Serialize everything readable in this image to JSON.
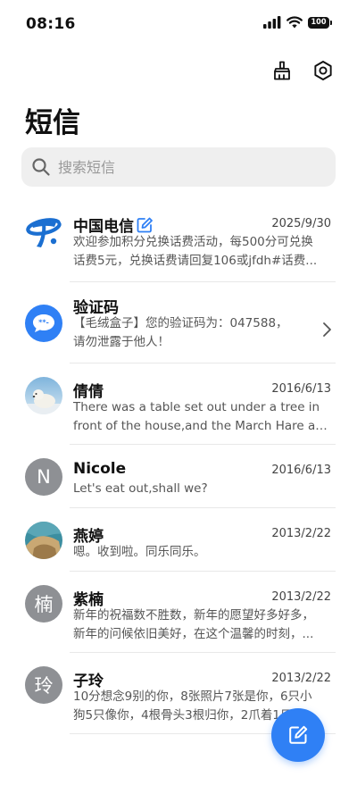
{
  "status_bar": {
    "time": "08:16",
    "battery": "100"
  },
  "header": {
    "title": "短信"
  },
  "search": {
    "placeholder": "搜索短信"
  },
  "colors": {
    "accent": "#2f80f5",
    "avatar_gray": "#8e9094"
  },
  "messages": [
    {
      "name": "中国电信",
      "avatar": "china-telecom-logo",
      "verified_icon": "edit-badge-icon",
      "date": "2025/9/30",
      "line1": "欢迎参加积分兑换话费活动，每500分可兑换",
      "line2": "话费5元，兑换话费请回复106或jfdh#话费..."
    },
    {
      "name": "验证码",
      "avatar": "sms-bubble-icon",
      "line1": "【毛绒盒子】您的验证码为：047588，",
      "line2": "请勿泄露于他人！"
    },
    {
      "name": "倩倩",
      "avatar": "polar-bear-photo",
      "date": "2016/6/13",
      "line1": "There was a table set out under a tree in",
      "line2": "front of the house,and the March Hare and..."
    },
    {
      "name": "Nicole",
      "avatar_letter": "N",
      "date": "2016/6/13",
      "line1": "Let's eat out,shall we?"
    },
    {
      "name": "燕婷",
      "avatar": "landscape-photo",
      "date": "2013/2/22",
      "line1": "嗯。收到啦。同乐同乐。"
    },
    {
      "name": "紫楠",
      "avatar_letter": "楠",
      "date": "2013/2/22",
      "line1": "新年的祝福数不胜数，新年的愿望好多好多，",
      "line2": "新年的问候依旧美好，在这个温馨的时刻，..."
    },
    {
      "name": "子玲",
      "avatar_letter": "玲",
      "date": "2013/2/22",
      "line1": "10分想念9别的你，8张照片7张是你，6只小",
      "line2": "狗5只像你，4根骨头3根归你，2爪着1只..."
    }
  ]
}
